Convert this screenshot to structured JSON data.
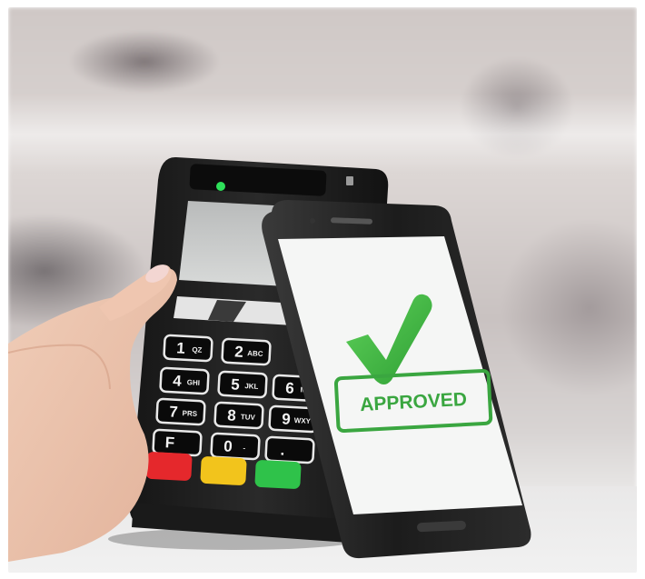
{
  "screen": {
    "stamp_text": "APPROVED",
    "check_icon": "check-mark-icon",
    "check_color": "#35b33a",
    "stamp_color": "#3aa640",
    "screen_color": "#f5f6f5"
  },
  "keypad": {
    "keys": [
      {
        "main": "1",
        "sub": "QZ"
      },
      {
        "main": "2",
        "sub": "ABC"
      },
      {
        "main": "4",
        "sub": "GHI"
      },
      {
        "main": "5",
        "sub": "JKL"
      },
      {
        "main": "6",
        "sub": "MN"
      },
      {
        "main": "7",
        "sub": "PRS"
      },
      {
        "main": "8",
        "sub": "TUV"
      },
      {
        "main": "9",
        "sub": "WXY"
      },
      {
        "main": "F",
        "sub": ""
      },
      {
        "main": "0",
        "sub": "-"
      },
      {
        "main": ".",
        "sub": ""
      }
    ],
    "cancel_color": "#e5282c",
    "clear_color": "#f2c41c",
    "enter_color": "#2fc24a"
  },
  "terminal": {
    "led_color": "#2ee05a"
  }
}
